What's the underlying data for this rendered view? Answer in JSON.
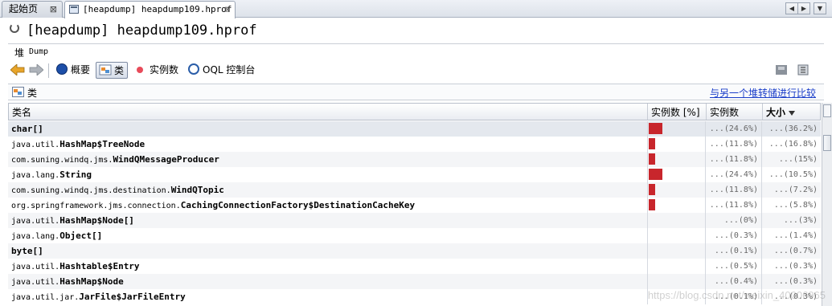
{
  "tabs": [
    {
      "label": "起始页",
      "active": false
    },
    {
      "label": "[heapdump] heapdump109.hprof",
      "active": true
    }
  ],
  "close_glyph": "⊠",
  "title": "[heapdump] heapdump109.hprof",
  "subtitle": {
    "heap": "堆",
    "dump": "Dump"
  },
  "toolbar": {
    "summary_label": "概要",
    "classes_label": "类",
    "instances_label": "实例数",
    "oql_label": "OQL 控制台"
  },
  "section": {
    "label": "类",
    "compare_link": "与另一个堆转储进行比较"
  },
  "table": {
    "columns": {
      "name": "类名",
      "instances_pct": "实例数 [%]",
      "instances": "实例数",
      "size": "大小"
    },
    "rows": [
      {
        "pkg": "",
        "cls": "char[]",
        "bar_pct": 24.6,
        "inst": "...(24.6%)",
        "size": "...(36.2%)"
      },
      {
        "pkg": "java.util.",
        "cls": "HashMap$TreeNode",
        "bar_pct": 11.8,
        "inst": "...(11.8%)",
        "size": "...(16.8%)"
      },
      {
        "pkg": "com.suning.windq.jms.",
        "cls": "WindQMessageProducer",
        "bar_pct": 11.8,
        "inst": "...(11.8%)",
        "size": "...(15%)"
      },
      {
        "pkg": "java.lang.",
        "cls": "String",
        "bar_pct": 24.4,
        "inst": "...(24.4%)",
        "size": "...(10.5%)"
      },
      {
        "pkg": "com.suning.windq.jms.destination.",
        "cls": "WindQTopic",
        "bar_pct": 11.8,
        "inst": "...(11.8%)",
        "size": "...(7.2%)"
      },
      {
        "pkg": "org.springframework.jms.connection.",
        "cls": "CachingConnectionFactory$DestinationCacheKey",
        "bar_pct": 11.8,
        "inst": "...(11.8%)",
        "size": "...(5.8%)"
      },
      {
        "pkg": "java.util.",
        "cls": "HashMap$Node[]",
        "bar_pct": 0,
        "inst": "...(0%)",
        "size": "...(3%)"
      },
      {
        "pkg": "java.lang.",
        "cls": "Object[]",
        "bar_pct": 0.3,
        "inst": "...(0.3%)",
        "size": "...(1.4%)"
      },
      {
        "pkg": "",
        "cls": "byte[]",
        "bar_pct": 0.1,
        "inst": "...(0.1%)",
        "size": "...(0.7%)"
      },
      {
        "pkg": "java.util.",
        "cls": "Hashtable$Entry",
        "bar_pct": 0.5,
        "inst": "...(0.5%)",
        "size": "...(0.3%)"
      },
      {
        "pkg": "java.util.",
        "cls": "HashMap$Node",
        "bar_pct": 0.4,
        "inst": "...(0.4%)",
        "size": "...(0.3%)"
      },
      {
        "pkg": "java.util.jar.",
        "cls": "JarFile$JarFileEntry",
        "bar_pct": 0.1,
        "inst": "...(0.1%)",
        "size": "...(0.3%)"
      }
    ]
  },
  "watermark": "https://blog.csdn.net/weixin_40006065",
  "colors": {
    "bar": "#c8262c",
    "link": "#1b3ec9"
  }
}
